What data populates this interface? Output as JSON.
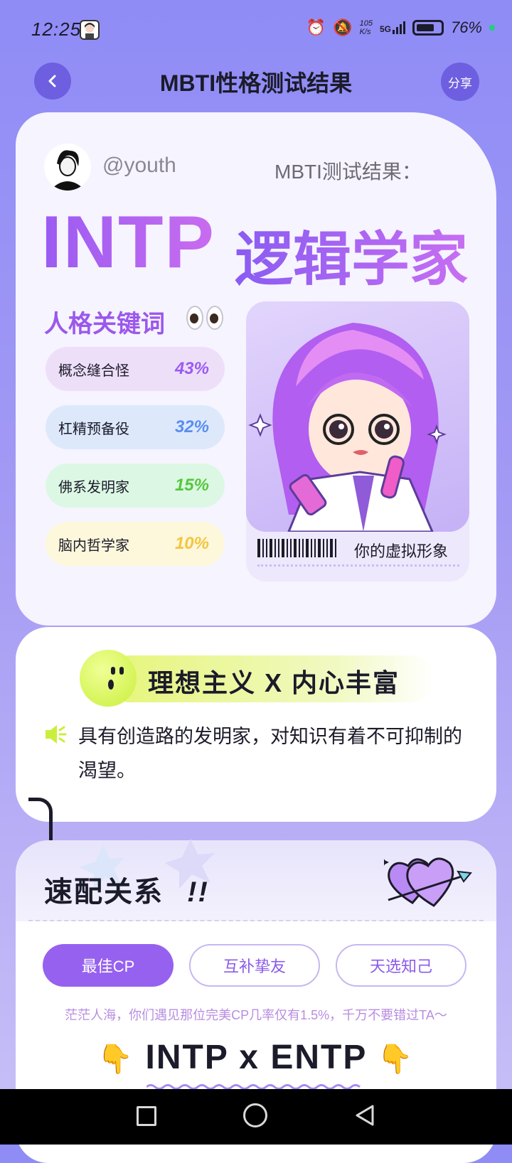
{
  "status_bar": {
    "time": "12:25",
    "net_speed_top": "105",
    "net_speed_bottom": "K/s",
    "network": "5G",
    "battery_pct": "76%",
    "battery_level": 0.76,
    "icons": [
      "alarm-icon",
      "mute-bell-icon",
      "signal-icon",
      "battery-icon"
    ]
  },
  "header": {
    "title": "MBTI性格测试结果",
    "share_label": "分享",
    "back_icon": "chevron-left-icon"
  },
  "profile": {
    "username": "@youth",
    "result_label": "MBTI测试结果："
  },
  "result": {
    "type": "INTP",
    "name": "逻辑学家"
  },
  "keywords": {
    "title": "人格关键词",
    "items": [
      {
        "label": "概念缝合怪",
        "pct": "43%",
        "bg": "#eedff9",
        "color": "#9a5bf2"
      },
      {
        "label": "杠精预备役",
        "pct": "32%",
        "bg": "#dde9fb",
        "color": "#5a8df0"
      },
      {
        "label": "佛系发明家",
        "pct": "15%",
        "bg": "#dcf8e4",
        "color": "#55c83d"
      },
      {
        "label": "脑内哲学家",
        "pct": "10%",
        "bg": "#fdf7db",
        "color": "#f3c640"
      }
    ]
  },
  "avatar_panel": {
    "caption": "你的虚拟形象"
  },
  "trait": {
    "title": "理想主义 X 内心丰富",
    "description": "具有创造路的发明家，对知识有着不可抑制的渴望。"
  },
  "match": {
    "title": "速配关系",
    "title_suffix": "!!",
    "tabs": [
      {
        "label": "最佳CP",
        "active": true
      },
      {
        "label": "互补挚友",
        "active": false
      },
      {
        "label": "天选知己",
        "active": false
      }
    ],
    "note": "茫茫人海，你们遇见那位完美CP几率仅有1.5%，千万不要错过TA～",
    "pair": "INTP x ENTP"
  },
  "colors": {
    "accent": "#9661ef",
    "background": "#8f8cf6",
    "lime": "#c9ef3c"
  }
}
